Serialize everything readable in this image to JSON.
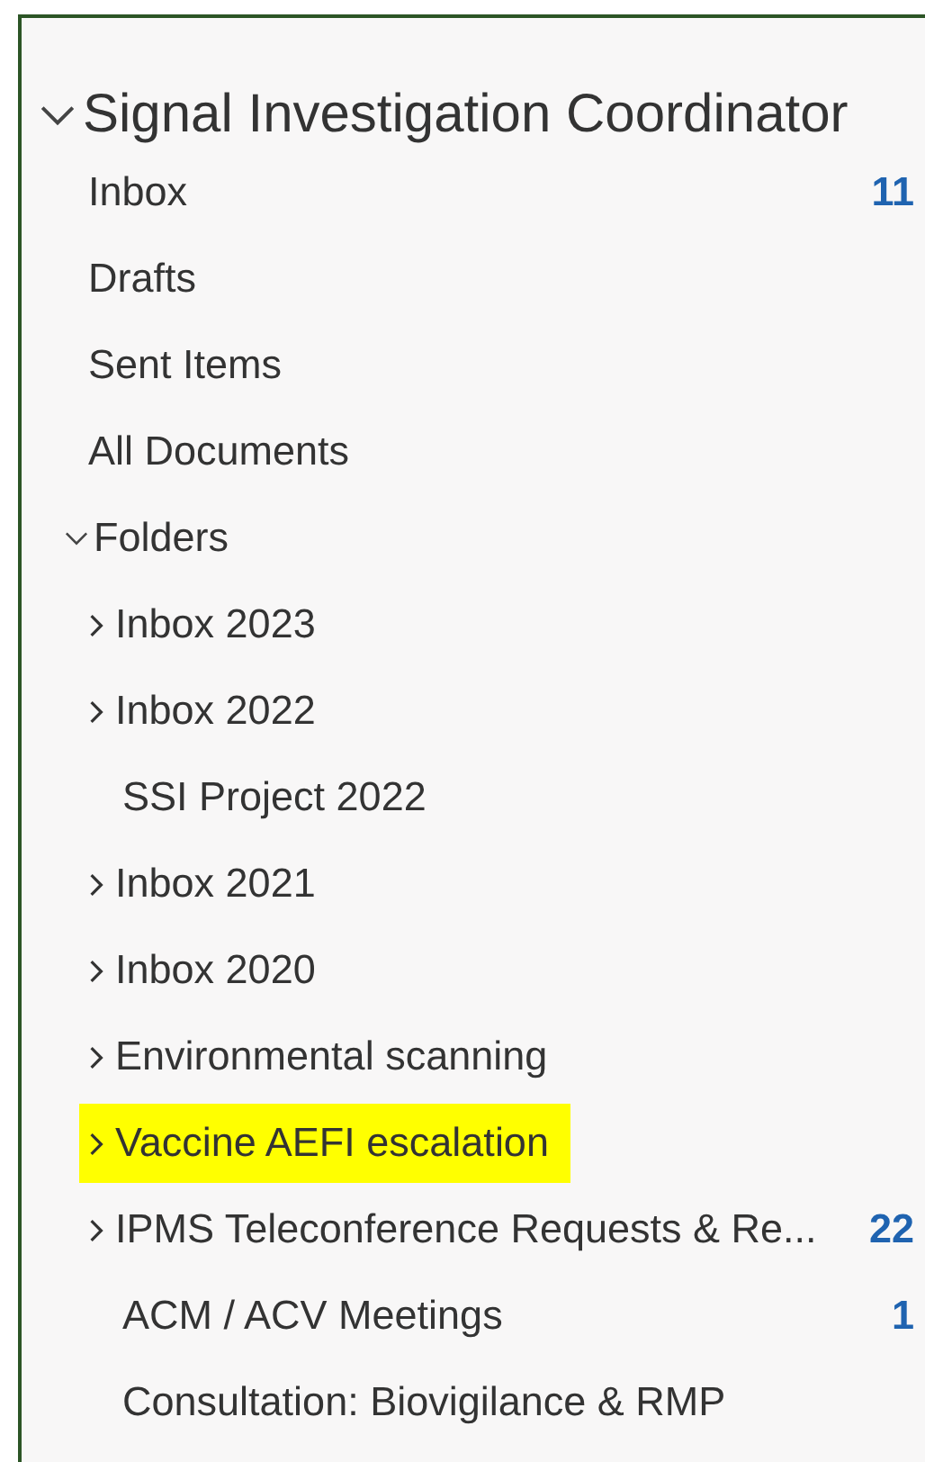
{
  "account": {
    "title": "Signal Investigation Coordinator",
    "expanded": true,
    "items": [
      {
        "label": "Inbox",
        "count": "11"
      },
      {
        "label": "Drafts"
      },
      {
        "label": "Sent Items"
      },
      {
        "label": "All Documents"
      }
    ],
    "folders": {
      "label": "Folders",
      "expanded": true,
      "children": [
        {
          "label": "Inbox 2023",
          "kind": "collapsed",
          "highlighted": false
        },
        {
          "label": "Inbox 2022",
          "kind": "collapsed",
          "highlighted": false
        },
        {
          "label": "SSI Project 2022",
          "kind": "leaf",
          "highlighted": false
        },
        {
          "label": "Inbox 2021",
          "kind": "collapsed",
          "highlighted": false
        },
        {
          "label": "Inbox 2020",
          "kind": "collapsed",
          "highlighted": false
        },
        {
          "label": "Environmental scanning",
          "kind": "collapsed",
          "highlighted": false
        },
        {
          "label": "Vaccine AEFI escalation",
          "kind": "collapsed",
          "highlighted": true
        },
        {
          "label": "IPMS Teleconference Requests & Re...",
          "kind": "collapsed",
          "highlighted": false,
          "count": "22"
        },
        {
          "label": "ACM / ACV Meetings",
          "kind": "leaf",
          "highlighted": false,
          "count": "1"
        },
        {
          "label": "Consultation: Biovigilance & RMP",
          "kind": "leaf",
          "highlighted": false
        }
      ]
    }
  }
}
